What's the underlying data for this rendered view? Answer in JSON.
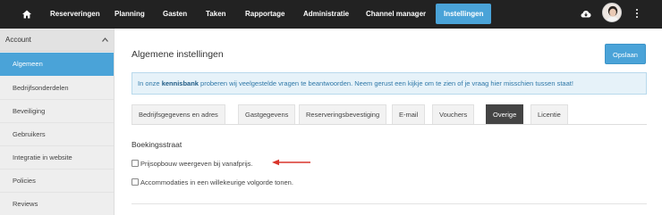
{
  "nav": {
    "items": [
      "Reserveringen",
      "Planning",
      "Gasten",
      "Taken",
      "Rapportage",
      "Administratie",
      "Channel manager",
      "Instellingen"
    ],
    "active": "Instellingen"
  },
  "sidebar": {
    "header": "Account",
    "items": [
      "Algemeen",
      "Bedrijfsonderdelen",
      "Beveiliging",
      "Gebruikers",
      "Integratie in website",
      "Policies",
      "Reviews"
    ],
    "active": "Algemeen"
  },
  "main": {
    "title": "Algemene instellingen",
    "save_label": "Opslaan",
    "info": {
      "prefix": "In onze ",
      "link": "kennisbank",
      "suffix": " proberen wij veelgestelde vragen te beantwoorden. Neem gerust een kijkje om te zien of je vraag hier misschien tussen staat!"
    },
    "tabs": [
      "Bedrijfsgegevens en adres",
      "Gastgegevens",
      "Reserveringsbevestiging",
      "E-mail",
      "Vouchers",
      "Overige",
      "Licentie"
    ],
    "active_tab": "Overige",
    "section_title": "Boekingsstraat",
    "options": [
      {
        "label": "Prijsopbouw weergeven bij vanafprijs.",
        "checked": false
      },
      {
        "label": "Accommodaties in een willekeurige volgorde tonen.",
        "checked": false
      }
    ]
  },
  "colors": {
    "accent": "#4aa3d8",
    "nav_bg": "#222222",
    "arrow": "#d9352b"
  }
}
